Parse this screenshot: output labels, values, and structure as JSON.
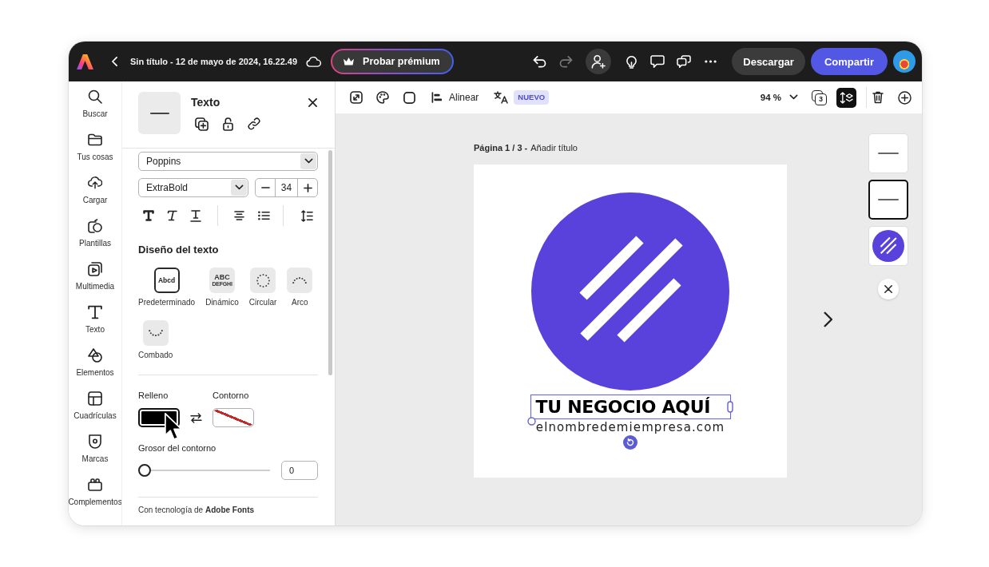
{
  "top_bar": {
    "title": "Sin título - 12 de mayo de 2024, 16.22.49",
    "premium_button": "Probar prémium",
    "undo_disabled": false,
    "redo_disabled": true,
    "download_button": "Descargar",
    "share_button": "Compartir"
  },
  "side_rail": {
    "items": [
      "Buscar",
      "Tus cosas",
      "Cargar",
      "Plantillas",
      "Multimedia",
      "Texto",
      "Elementos",
      "Cuadrículas",
      "Marcas",
      "Complementos"
    ]
  },
  "panel": {
    "title": "Texto",
    "font": "Poppins",
    "weight": "ExtraBold",
    "size": "34",
    "layout_heading": "Diseño del texto",
    "layouts": [
      {
        "label": "Predeterminado",
        "kind": "plain",
        "preview": "Abcd",
        "selected": true
      },
      {
        "label": "Dinámico",
        "kind": "stacked",
        "preview": "ABC",
        "preview_2": "DEFGHI",
        "selected": false
      },
      {
        "label": "Circular",
        "kind": "circle",
        "selected": false
      },
      {
        "label": "Arco",
        "kind": "arc",
        "selected": false
      },
      {
        "label": "Combado",
        "kind": "bend",
        "selected": false
      }
    ],
    "paint": [
      {
        "label": "Relleno",
        "kind": "solid",
        "color": "#000000",
        "selected": true
      },
      {
        "label": "Contorno",
        "kind": "none",
        "selected": false
      }
    ],
    "stroke_width": {
      "label": "Grosor del contorno",
      "level": 0,
      "value": "0"
    },
    "footer": "Con tecnología de **Adobe Fonts**"
  },
  "toolbar": {
    "align_label": "Alinear",
    "new_badge": "NUEVO",
    "zoom": "94 %",
    "page_count": "3",
    "reorder_selected": true
  },
  "canvas": {
    "page_label": "Página 1 / 3 -",
    "add_title": "Añadir título",
    "design": {
      "headline": "TU NEGOCIO AQUÍ",
      "headline_selected": true,
      "url": "elnombredemiempresa.com"
    },
    "pages": [
      {
        "kind": "text",
        "selected": false
      },
      {
        "kind": "text",
        "selected": true
      },
      {
        "kind": "logo",
        "selected": false
      }
    ]
  }
}
